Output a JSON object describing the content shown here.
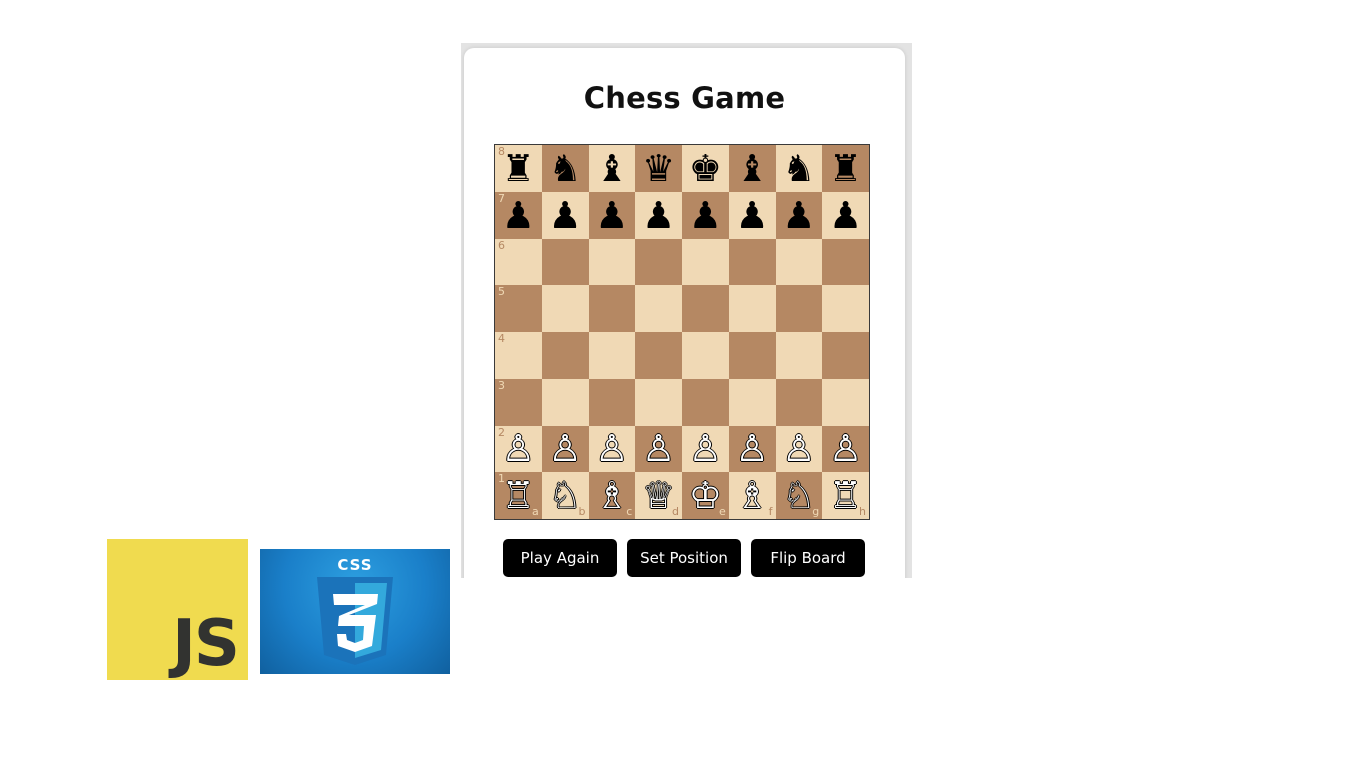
{
  "game": {
    "title": "Chess Game",
    "ranks": [
      "8",
      "7",
      "6",
      "5",
      "4",
      "3",
      "2",
      "1"
    ],
    "files": [
      "a",
      "b",
      "c",
      "d",
      "e",
      "f",
      "g",
      "h"
    ],
    "light_color": "#f0d9b5",
    "dark_color": "#b58863",
    "board": [
      [
        "♜",
        "♞",
        "♝",
        "♛",
        "♚",
        "♝",
        "♞",
        "♜"
      ],
      [
        "♟",
        "♟",
        "♟",
        "♟",
        "♟",
        "♟",
        "♟",
        "♟"
      ],
      [
        "",
        "",
        "",
        "",
        "",
        "",
        "",
        ""
      ],
      [
        "",
        "",
        "",
        "",
        "",
        "",
        "",
        ""
      ],
      [
        "",
        "",
        "",
        "",
        "",
        "",
        "",
        ""
      ],
      [
        "",
        "",
        "",
        "",
        "",
        "",
        "",
        ""
      ],
      [
        "♙",
        "♙",
        "♙",
        "♙",
        "♙",
        "♙",
        "♙",
        "♙"
      ],
      [
        "♖",
        "♘",
        "♗",
        "♕",
        "♔",
        "♗",
        "♘",
        "♖"
      ]
    ],
    "buttons": {
      "play_again": "Play Again",
      "set_position": "Set Position",
      "flip_board": "Flip Board"
    }
  },
  "logos": {
    "js": {
      "text": "JS",
      "color": "#f0db4f"
    },
    "css": {
      "text": "CSS",
      "color": "#1a7fc9"
    }
  }
}
